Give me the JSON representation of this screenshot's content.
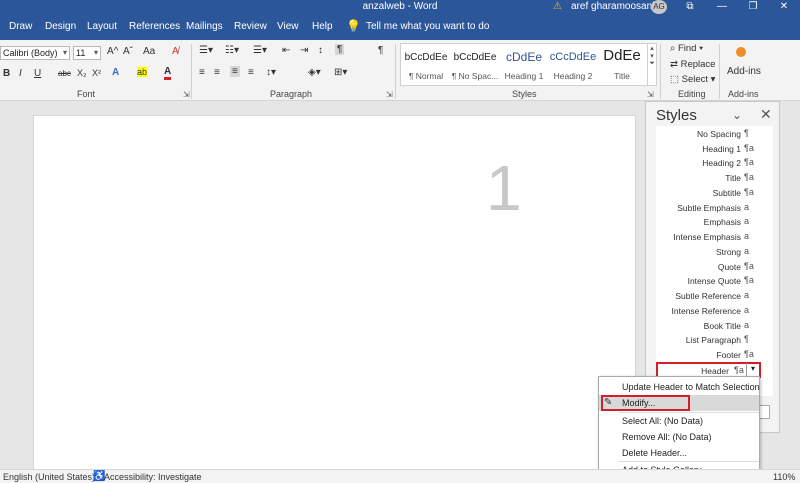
{
  "window": {
    "title": "anzalweb - Word",
    "user": "aref gharamoosanloo",
    "avatar_initials": "AG",
    "warning_icon": "warning-icon",
    "controls": [
      "⧉",
      "—",
      "❐",
      "✕"
    ]
  },
  "menu": {
    "tabs": [
      "Draw",
      "Design",
      "Layout",
      "References",
      "Mailings",
      "Review",
      "View",
      "Help"
    ],
    "tell_me": "Tell me what you want to do"
  },
  "ribbon": {
    "font": {
      "name": "Calibri (Body)",
      "size": "11",
      "grow": "A^",
      "shrink": "Aˇ",
      "case": "Aa",
      "clear": "A̸",
      "bold": "B",
      "italic": "I",
      "underline": "U",
      "strike": "abc",
      "subscript": "X₂",
      "superscript": "X²",
      "effects": "A",
      "highlight": "ab",
      "color": "A",
      "label": "Font"
    },
    "paragraph": {
      "label": "Paragraph",
      "pilcrow": "¶"
    },
    "styles": {
      "label": "Styles",
      "items": [
        {
          "sample": "bCcDdEe",
          "name": "¶ Normal"
        },
        {
          "sample": "bCcDdEe",
          "name": "¶ No Spac..."
        },
        {
          "sample": "cDdEe",
          "name": "Heading 1"
        },
        {
          "sample": "cCcDdEe",
          "name": "Heading 2"
        },
        {
          "sample": "DdEe",
          "name": "Title"
        }
      ]
    },
    "editing": {
      "label": "Editing",
      "find": "Find",
      "replace": "Replace",
      "select": "Select"
    },
    "addins": {
      "label": "Add-ins",
      "button": "Add-ins"
    }
  },
  "document": {
    "page_number": "1"
  },
  "styles_pane": {
    "title": "Styles",
    "items": [
      {
        "label": "No Spacing",
        "sym": "¶"
      },
      {
        "label": "Heading 1",
        "sym": "¶a"
      },
      {
        "label": "Heading 2",
        "sym": "¶a"
      },
      {
        "label": "Title",
        "sym": "¶a"
      },
      {
        "label": "Subtitle",
        "sym": "¶a"
      },
      {
        "label": "Subtle Emphasis",
        "sym": "a"
      },
      {
        "label": "Emphasis",
        "sym": "a"
      },
      {
        "label": "Intense Emphasis",
        "sym": "a"
      },
      {
        "label": "Strong",
        "sym": "a"
      },
      {
        "label": "Quote",
        "sym": "¶a"
      },
      {
        "label": "Intense Quote",
        "sym": "¶a"
      },
      {
        "label": "Subtle Reference",
        "sym": "a"
      },
      {
        "label": "Intense Reference",
        "sym": "a"
      },
      {
        "label": "Book Title",
        "sym": "a"
      },
      {
        "label": "List Paragraph",
        "sym": "¶"
      },
      {
        "label": "Footer",
        "sym": "¶a"
      },
      {
        "label": "Header",
        "sym": "¶a"
      }
    ]
  },
  "context_menu": {
    "items": [
      "Update Header to Match Selection",
      "Modify...",
      "Select All: (No Data)",
      "Remove All: (No Data)",
      "Delete Header...",
      "Add to Style Gallery"
    ]
  },
  "status": {
    "language": "English (United States)",
    "accessibility": "Accessibility: Investigate",
    "zoom": "110%"
  }
}
